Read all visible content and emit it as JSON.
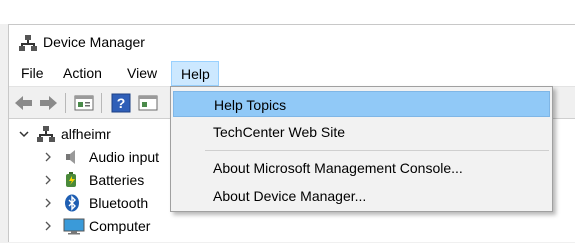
{
  "window": {
    "title": "Device Manager"
  },
  "menubar": {
    "items": [
      {
        "label": "File"
      },
      {
        "label": "Action"
      },
      {
        "label": "View"
      },
      {
        "label": "Help"
      }
    ],
    "active": "Help"
  },
  "toolbar": {
    "buttons": [
      "back-arrow-icon",
      "forward-arrow-icon",
      "properties-icon",
      "help-icon",
      "properties-pane-icon"
    ]
  },
  "tree": {
    "root": {
      "label": "alfheimr",
      "expanded": true
    },
    "children": [
      {
        "label": "Audio input",
        "icon": "speaker-icon"
      },
      {
        "label": "Batteries",
        "icon": "battery-icon"
      },
      {
        "label": "Bluetooth",
        "icon": "bluetooth-icon"
      },
      {
        "label": "Computer",
        "icon": "monitor-icon"
      }
    ]
  },
  "help_menu": {
    "items": [
      {
        "label": "Help Topics",
        "highlighted": true
      },
      {
        "label": "TechCenter Web Site"
      },
      {
        "label": "About Microsoft Management Console..."
      },
      {
        "label": "About Device Manager..."
      }
    ]
  },
  "colors": {
    "menu_highlight": "#91c9f7",
    "menubar_active": "#cce8ff",
    "bluetooth": "#1f5fb3"
  }
}
